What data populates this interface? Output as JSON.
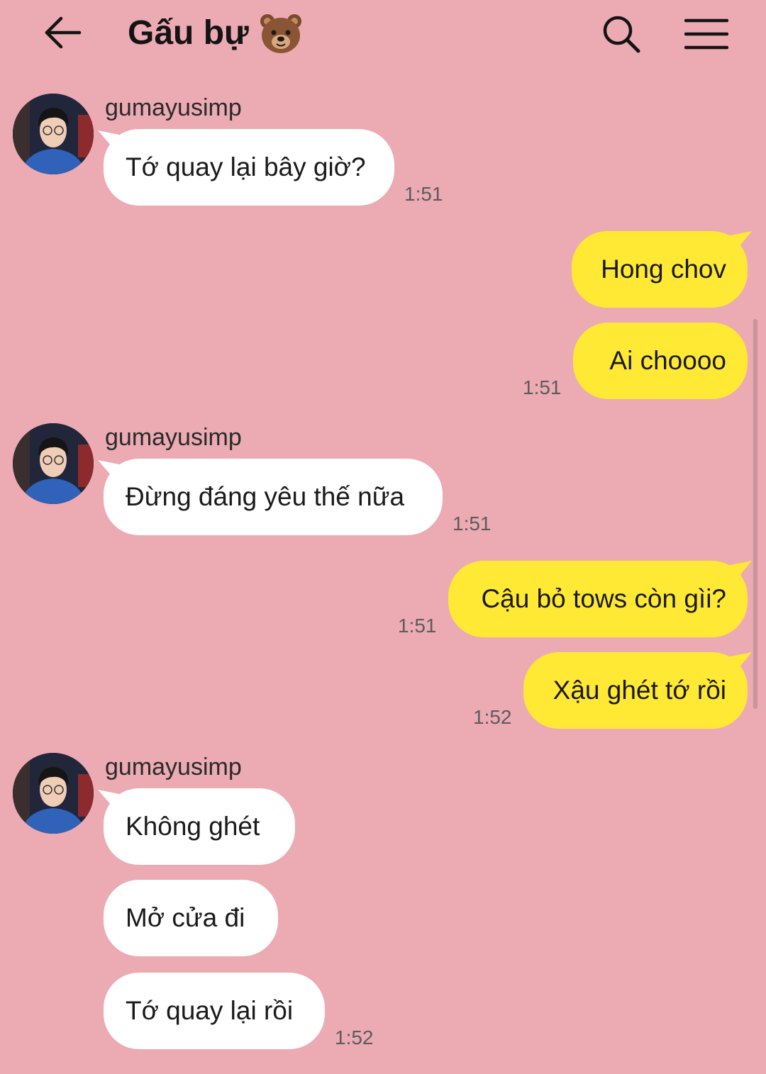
{
  "header": {
    "title": "Gấu bự",
    "title_emoji_icon": "bear-face-icon"
  },
  "colors": {
    "background": "#ecaab3",
    "incoming_bubble": "#ffffff",
    "outgoing_bubble": "#ffe934"
  },
  "messages": [
    {
      "direction": "in",
      "sender": "gumayusimp",
      "text": "Tớ quay lại bây giờ?",
      "time": "1:51"
    },
    {
      "direction": "out",
      "text": "Hong chov"
    },
    {
      "direction": "out",
      "text": "Ai choooo",
      "time": "1:51"
    },
    {
      "direction": "in",
      "sender": "gumayusimp",
      "text": "Đừng đáng yêu thế nữa",
      "time": "1:51"
    },
    {
      "direction": "out",
      "text": "Cậu bỏ tows còn gìi?",
      "time": "1:51"
    },
    {
      "direction": "out",
      "text": "Xậu ghét tớ rồi",
      "time": "1:52"
    },
    {
      "direction": "in",
      "sender": "gumayusimp",
      "text": "Không ghét"
    },
    {
      "direction": "in",
      "text": "Mở cửa đi"
    },
    {
      "direction": "in",
      "text": "Tớ quay lại rồi",
      "time": "1:52"
    }
  ]
}
